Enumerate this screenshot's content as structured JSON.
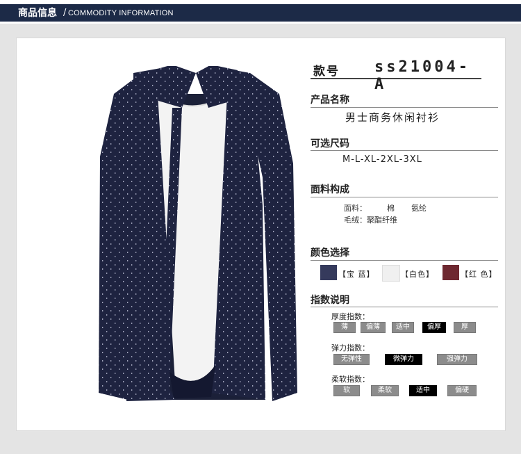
{
  "header": {
    "title": "商品信息",
    "slash": "/",
    "subtitle": "COMMODITY INFORMATION"
  },
  "product": {
    "image_alt": "navy dotted long-sleeve shirt",
    "model_label": "款号",
    "model_value": "ss21004-A",
    "name_title": "产品名称",
    "name_value": "男士商务休闲衬衫",
    "size_title": "可选尺码",
    "size_value": "M-L-XL-2XL-3XL",
    "fabric_title": "面料构成",
    "fabric_row1_label": "面料：",
    "fabric_row1_v1": "棉",
    "fabric_row1_v2": "氨纶",
    "fabric_row2": "毛绒：聚酯纤维",
    "color_title": "颜色选择",
    "colors": [
      {
        "label": "【宝 蓝】",
        "hex": "#353a5c"
      },
      {
        "label": "【白色】",
        "hex": "#f0f0f0"
      },
      {
        "label": "【红 色】",
        "hex": "#6e2830"
      }
    ],
    "index_title": "指数说明",
    "indices": [
      {
        "label": "厚度指数：",
        "options": [
          "薄",
          "偏薄",
          "适中",
          "偏厚",
          "厚"
        ],
        "selected": 3
      },
      {
        "label": "弹力指数：",
        "options": [
          "无弹性",
          "微弹力",
          "强弹力"
        ],
        "selected": 1
      },
      {
        "label": "柔软指数：",
        "options": [
          "软",
          "柔软",
          "适中",
          "偏硬"
        ],
        "selected": 2
      }
    ]
  }
}
